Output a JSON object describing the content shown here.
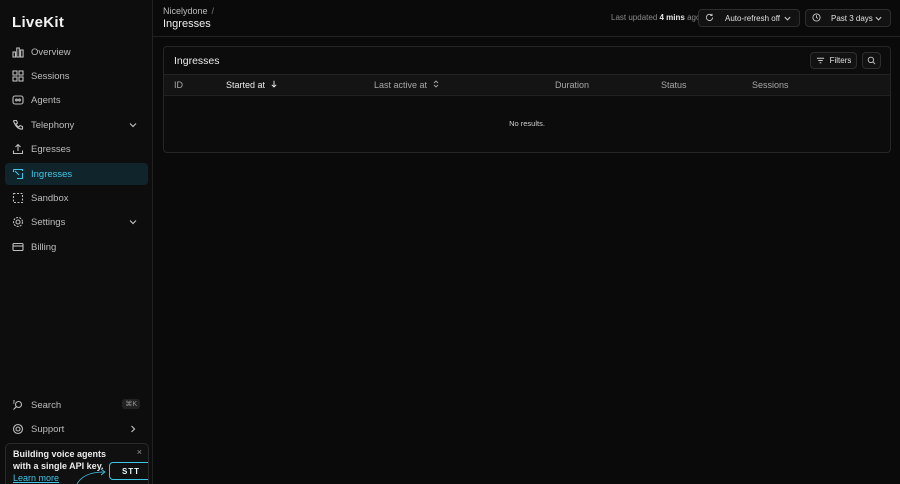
{
  "sidebar": {
    "logo": "LiveKit",
    "items": [
      {
        "label": "Overview"
      },
      {
        "label": "Sessions"
      },
      {
        "label": "Agents"
      },
      {
        "label": "Telephony"
      },
      {
        "label": "Egresses"
      },
      {
        "label": "Ingresses"
      },
      {
        "label": "Sandbox"
      },
      {
        "label": "Settings"
      },
      {
        "label": "Billing"
      }
    ],
    "bottom": {
      "search_label": "Search",
      "search_shortcut": "⌘K",
      "support_label": "Support"
    },
    "promo": {
      "text": "Building voice agents with a single API key.",
      "link": "Learn more",
      "badge": "STT",
      "close": "×"
    }
  },
  "header": {
    "breadcrumb": "Nicelydone",
    "breadcrumb_sep": "/",
    "title": "Ingresses",
    "last_updated_prefix": "Last updated",
    "last_updated_value": "4 mins",
    "last_updated_suffix": "ago",
    "auto_refresh": "Auto-refresh off",
    "time_range": "Past 3 days"
  },
  "panel": {
    "title": "Ingresses",
    "filters_label": "Filters",
    "columns": [
      "ID",
      "Started at",
      "Last active at",
      "Duration",
      "Status",
      "Sessions"
    ],
    "empty_message": "No results."
  },
  "colors": {
    "accent": "#3ec7e8",
    "active_bg": "#10242b",
    "background": "#0a0a0a"
  }
}
